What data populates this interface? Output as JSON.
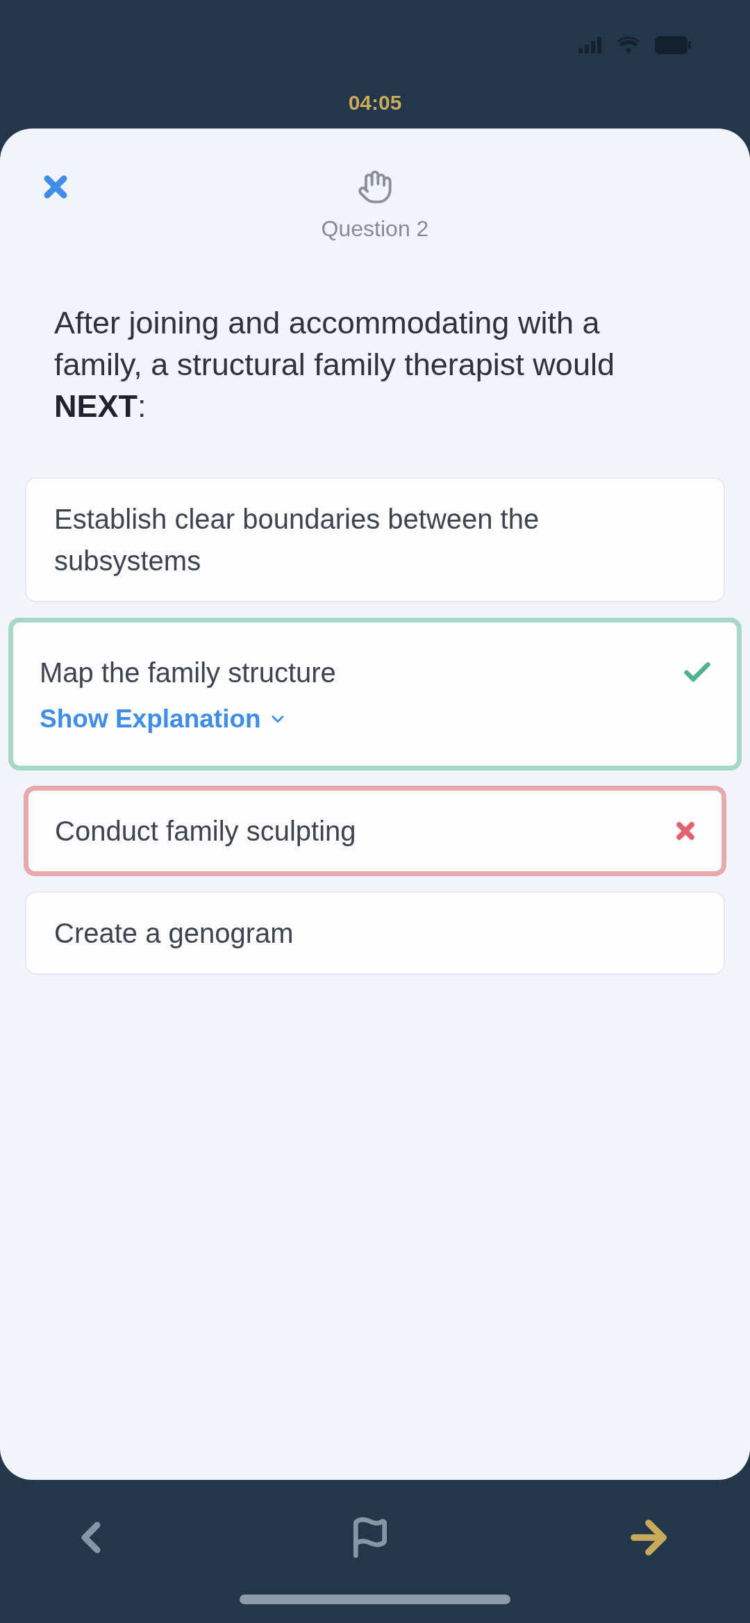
{
  "timer": {
    "text": "04:05"
  },
  "header": {
    "question_label": "Question 2"
  },
  "question": {
    "text": "After joining and accommodating with a family, a structural family therapist would **NEXT**:"
  },
  "answers": [
    {
      "text": "Establish clear boundaries between the subsystems",
      "correct": false,
      "incorrect": false
    },
    {
      "text": "Map the family structure",
      "correct": true,
      "incorrect": false,
      "explanation_link": "Show Explanation"
    },
    {
      "text": "Conduct family sculpting",
      "correct": false,
      "incorrect": true
    },
    {
      "text": "Create a genogram",
      "correct": false,
      "incorrect": false
    }
  ]
}
